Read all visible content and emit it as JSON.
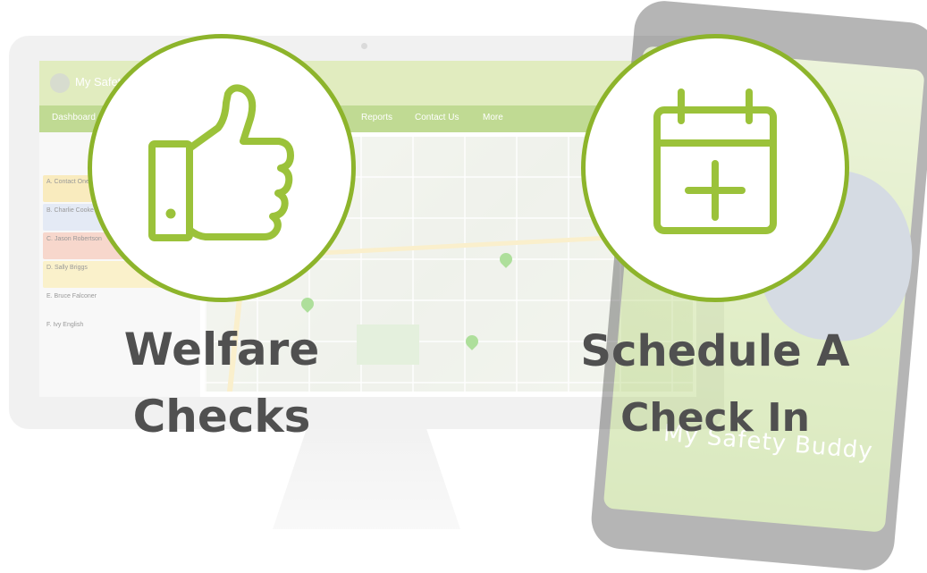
{
  "background_app": {
    "brand": "My Safety Buddy",
    "nav": [
      "Dashboard",
      "Reports",
      "Contact Us",
      "More"
    ],
    "contacts": [
      {
        "label": "A. Contact One",
        "color": "#f5dc8a"
      },
      {
        "label": "B. Charlie Cooke",
        "color": "#cfd9ee"
      },
      {
        "label": "C. Jason Robertson",
        "color": "#f1b7a3"
      },
      {
        "label": "D. Sally Briggs",
        "color": "#f7e6a1"
      },
      {
        "label": "E. Bruce Falconer",
        "color": "#f4f4f4"
      },
      {
        "label": "F. Ivy English",
        "color": "#f4f4f4"
      }
    ]
  },
  "phone": {
    "brand": "My Safety Buddy"
  },
  "features": [
    {
      "id": "welfare",
      "title_line1": "Welfare",
      "title_line2": "Checks",
      "icon": "thumbs-up-icon"
    },
    {
      "id": "schedule",
      "title_line1": "Schedule A",
      "title_line2": "Check In",
      "icon": "calendar-plus-icon"
    }
  ],
  "colors": {
    "accent": "#8db42b",
    "icon": "#9bc23a",
    "title": "#505050"
  }
}
